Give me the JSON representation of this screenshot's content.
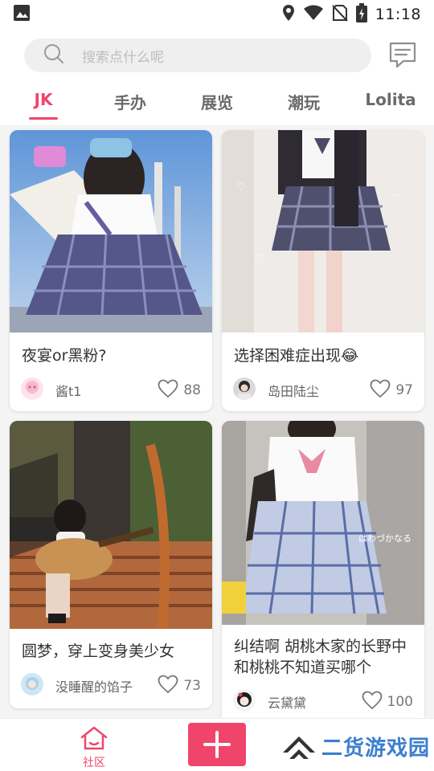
{
  "status_bar": {
    "time": "11:18",
    "icons": [
      "image-icon",
      "location-icon",
      "wifi-icon",
      "no-sim-icon",
      "battery-charging-icon"
    ]
  },
  "search": {
    "placeholder": "搜索点什么呢",
    "icon": "search-icon",
    "message_icon": "message-icon"
  },
  "tabs": [
    {
      "label": "JK",
      "active": true
    },
    {
      "label": "手办",
      "active": false
    },
    {
      "label": "展览",
      "active": false
    },
    {
      "label": "潮玩",
      "active": false
    },
    {
      "label": "Lolita",
      "active": false
    }
  ],
  "posts": [
    {
      "title": "夜宴or黑粉?",
      "author": "酱t1",
      "likes": "88"
    },
    {
      "title": "选择困难症出现😂",
      "author": "岛田陆尘",
      "likes": "97"
    },
    {
      "title": "圆梦，穿上变身美少女",
      "author": "没睡醒的馅子",
      "likes": "73"
    },
    {
      "title": "纠结啊  胡桃木家的长野中和桃桃不知道买哪个",
      "author": "云黛黛",
      "likes": "100"
    }
  ],
  "bottom_nav": {
    "community_label": "社区",
    "add_icon": "plus-icon",
    "watermark_text": "二货游戏园"
  },
  "colors": {
    "accent": "#f0456b",
    "watermark": "#3b7fcf"
  }
}
